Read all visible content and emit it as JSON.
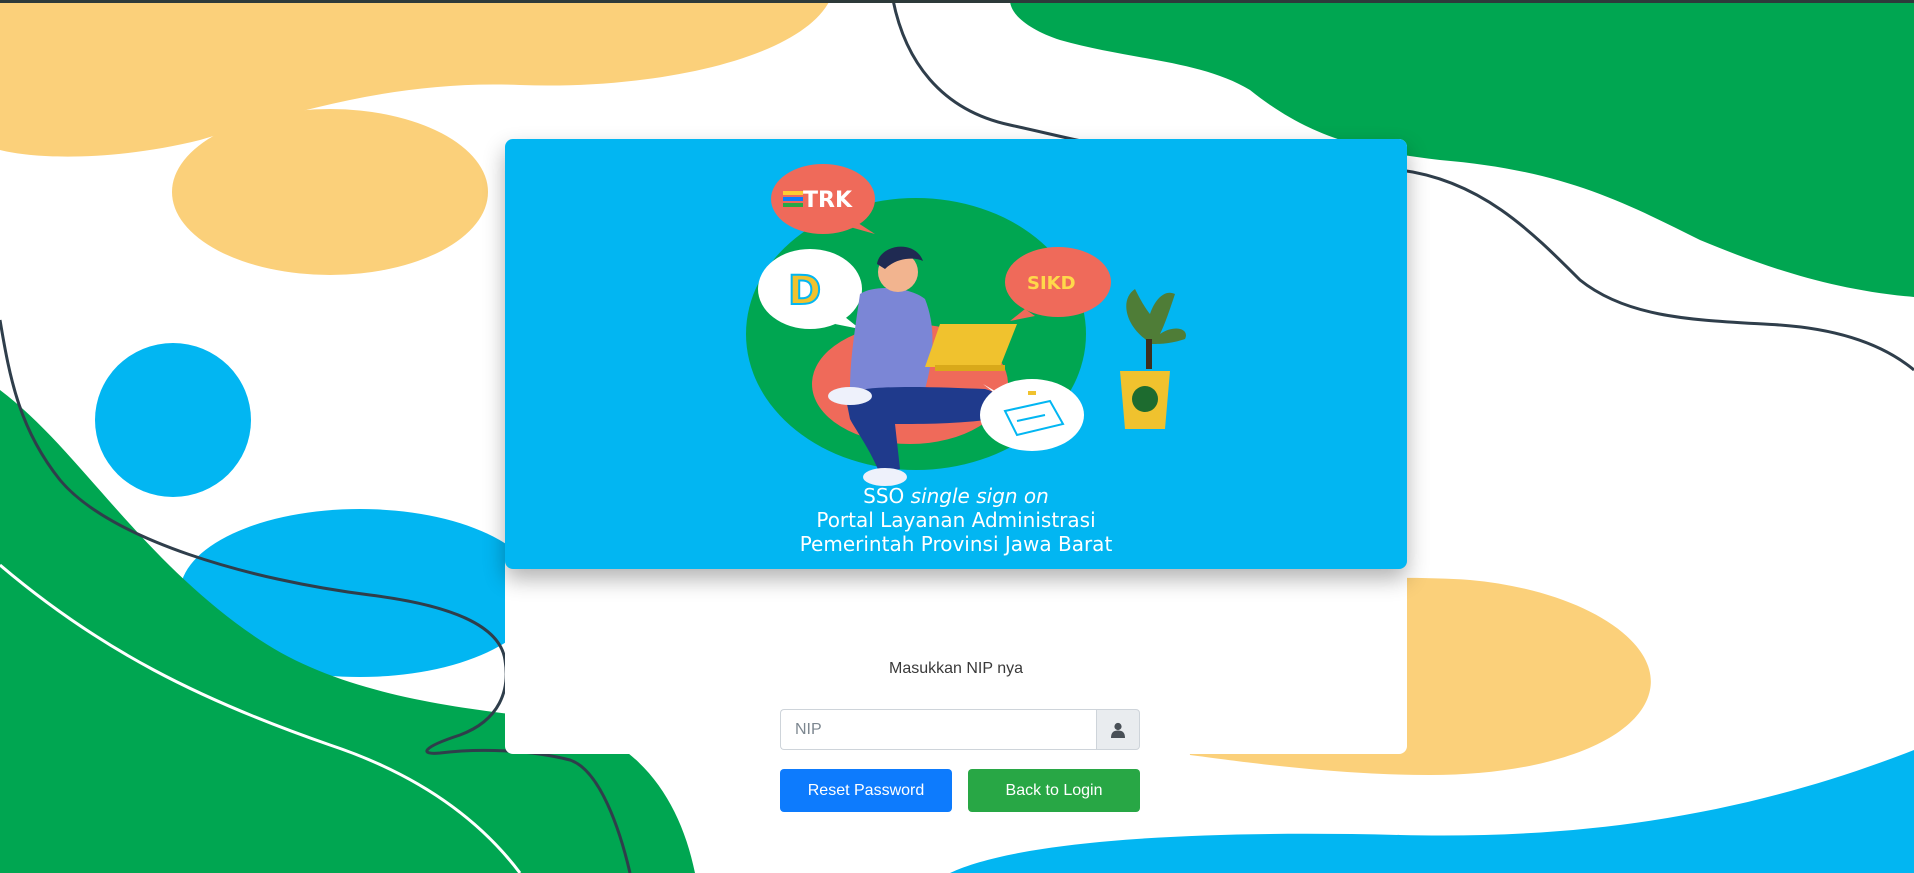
{
  "banner": {
    "logos": [
      "TRK",
      "SIKD",
      "D"
    ],
    "line1_prefix": "SSO",
    "line1_italic": "single sign on",
    "line2": "Portal Layanan Administrasi",
    "line3": "Pemerintah Provinsi Jawa Barat"
  },
  "form": {
    "prompt": "Masukkan NIP nya",
    "nip_placeholder": "NIP",
    "nip_value": "",
    "addon_icon": "user-icon"
  },
  "buttons": {
    "reset": "Reset Password",
    "back": "Back to Login"
  },
  "colors": {
    "banner_blue": "#02b6f2",
    "green": "#00a651",
    "yellow": "#fbd07a",
    "primary": "#0d7bfd",
    "success": "#28a745"
  }
}
